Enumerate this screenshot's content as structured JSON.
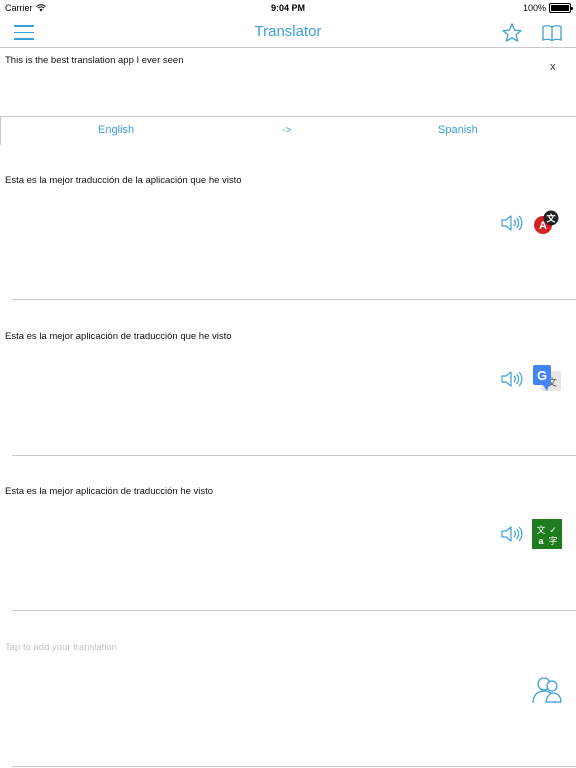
{
  "status_bar": {
    "carrier": "Carrier",
    "time": "9:04 PM",
    "battery": "100%",
    "battery_level": 1.0
  },
  "nav": {
    "title": "Translator",
    "menu_icon": "hamburger-menu-icon",
    "favorite_icon": "star-icon",
    "book_icon": "book-icon"
  },
  "source": {
    "text": "This is the best translation app I ever seen",
    "clear_label": "x"
  },
  "languages": {
    "from": "English",
    "swap": "->",
    "to": "Spanish"
  },
  "results": [
    {
      "text": "Esta es la mejor traducción de la aplicación que he visto",
      "provider": "provider-a-icon"
    },
    {
      "text": "Esta es la mejor aplicación de traducción que he visto",
      "provider": "google-translate-icon"
    },
    {
      "text": "Esta es la mejor aplicación de traducción he visto",
      "provider": "bing-translator-icon"
    }
  ],
  "add_translation": {
    "placeholder": "Tap to add your translation",
    "icon": "user-contribute-icon"
  },
  "colors": {
    "accent": "#3b9fd8",
    "divider": "#c8c8c8",
    "placeholder": "#c4c4c4",
    "provider_a_red": "#d42027",
    "google_blue": "#4285f4",
    "bing_green": "#1e7b1e"
  }
}
